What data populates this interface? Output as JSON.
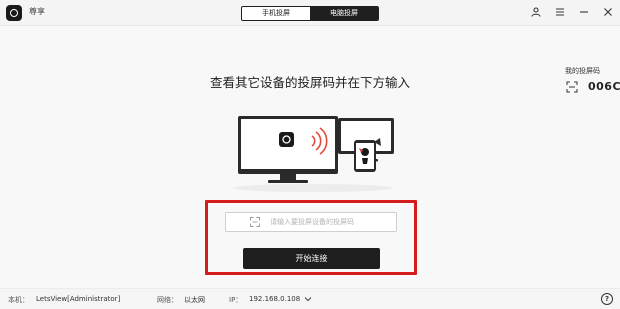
{
  "window": {
    "app_name": "尊享",
    "icons": [
      "user-icon",
      "menu-icon",
      "minimize-icon",
      "close-icon"
    ]
  },
  "mode_switch": {
    "tabs": [
      {
        "label": "手机投屏",
        "active": false
      },
      {
        "label": "电脑投屏",
        "active": true
      }
    ]
  },
  "my_code": {
    "label": "我的投屏码",
    "value": "006C"
  },
  "main": {
    "heading": "查看其它设备的投屏码并在下方输入",
    "input_placeholder": "请输入要投屏设备的投屏码",
    "connect_label": "开始连接"
  },
  "status": {
    "host_label": "本机：",
    "host_value": "LetsView[Administrator]",
    "network_label": "网络：",
    "network_value": "以太网",
    "ip_label": "IP：",
    "ip_value": "192.168.0.108",
    "help": "?"
  },
  "colors": {
    "accent": "#1e1e1e",
    "highlight": "#d41c1c",
    "signal": "#e04a3a"
  }
}
